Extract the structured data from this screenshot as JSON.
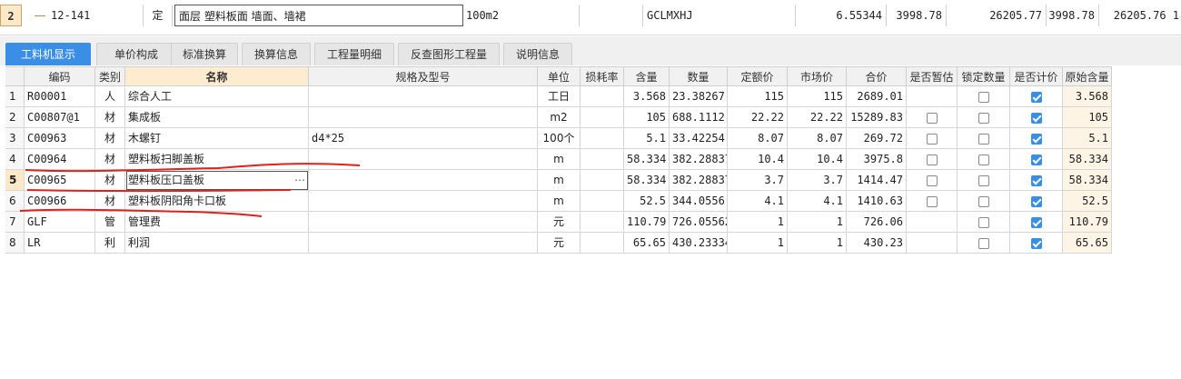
{
  "upper_row": {
    "row_num": "2",
    "code": "12-141",
    "type": "定",
    "name": "面层 塑料板面 墙面、墙裙",
    "unit": "100m2",
    "formula": "GCLMXHJ",
    "qty": "6.55344",
    "unit_price": "3998.78",
    "total": "26205.77",
    "unit_price2": "3998.78",
    "total2": "26205.76 1"
  },
  "tabs": [
    {
      "label": "工料机显示",
      "active": true
    },
    {
      "label": "单价构成"
    },
    {
      "label": "标准换算"
    },
    {
      "label": "换算信息"
    },
    {
      "label": "工程量明细"
    },
    {
      "label": "反查图形工程量"
    },
    {
      "label": "说明信息"
    }
  ],
  "columns": {
    "code": "编码",
    "type": "类别",
    "name": "名称",
    "spec": "规格及型号",
    "unit": "单位",
    "loss": "损耗率",
    "content": "含量",
    "quantity": "数量",
    "quota_price": "定额价",
    "market_price": "市场价",
    "total": "合价",
    "is_estimate": "是否暂估",
    "lock_qty": "锁定数量",
    "is_priced": "是否计价",
    "orig_content": "原始含量"
  },
  "rows": [
    {
      "n": "1",
      "code": "R00001",
      "type": "人",
      "name": "综合人工",
      "spec": "",
      "unit": "工日",
      "loss": "",
      "content": "3.568",
      "quantity": "23.38267",
      "quota": "115",
      "market": "115",
      "total": "2689.01",
      "est": null,
      "lock": false,
      "priced": true,
      "orig": "3.568"
    },
    {
      "n": "2",
      "code": "C00807@1",
      "type": "材",
      "name": "集成板",
      "spec": "",
      "unit": "m2",
      "loss": "",
      "content": "105",
      "quantity": "688.1112",
      "quota": "22.22",
      "market": "22.22",
      "total": "15289.83",
      "est": false,
      "lock": false,
      "priced": true,
      "orig": "105"
    },
    {
      "n": "3",
      "code": "C00963",
      "type": "材",
      "name": "木螺钉",
      "spec": "d4*25",
      "unit": "100个",
      "loss": "",
      "content": "5.1",
      "quantity": "33.42254",
      "quota": "8.07",
      "market": "8.07",
      "total": "269.72",
      "est": false,
      "lock": false,
      "priced": true,
      "orig": "5.1"
    },
    {
      "n": "4",
      "code": "C00964",
      "type": "材",
      "name": "塑料板扫脚盖板",
      "spec": "",
      "unit": "m",
      "loss": "",
      "content": "58.334",
      "quantity": "382.28837",
      "quota": "10.4",
      "market": "10.4",
      "total": "3975.8",
      "est": false,
      "lock": false,
      "priced": true,
      "orig": "58.334"
    },
    {
      "n": "5",
      "code": "C00965",
      "type": "材",
      "name": "塑料板压口盖板",
      "spec": "",
      "unit": "m",
      "loss": "",
      "content": "58.334",
      "quantity": "382.28837",
      "quota": "3.7",
      "market": "3.7",
      "total": "1414.47",
      "est": false,
      "lock": false,
      "priced": true,
      "orig": "58.334",
      "selected": true
    },
    {
      "n": "6",
      "code": "C00966",
      "type": "材",
      "name": "塑料板阴阳角卡口板",
      "spec": "",
      "unit": "m",
      "loss": "",
      "content": "52.5",
      "quantity": "344.0556",
      "quota": "4.1",
      "market": "4.1",
      "total": "1410.63",
      "est": false,
      "lock": false,
      "priced": true,
      "orig": "52.5"
    },
    {
      "n": "7",
      "code": "GLF",
      "type": "管",
      "name": "管理费",
      "spec": "",
      "unit": "元",
      "loss": "",
      "content": "110.79",
      "quantity": "726.05562",
      "quota": "1",
      "market": "1",
      "total": "726.06",
      "est": null,
      "lock": false,
      "priced": true,
      "orig": "110.79"
    },
    {
      "n": "8",
      "code": "LR",
      "type": "利",
      "name": "利润",
      "spec": "",
      "unit": "元",
      "loss": "",
      "content": "65.65",
      "quantity": "430.23334",
      "quota": "1",
      "market": "1",
      "total": "430.23",
      "est": null,
      "lock": false,
      "priced": true,
      "orig": "65.65"
    }
  ],
  "accent_color": "#3a8ee6",
  "annotation_color": "#e0201a"
}
